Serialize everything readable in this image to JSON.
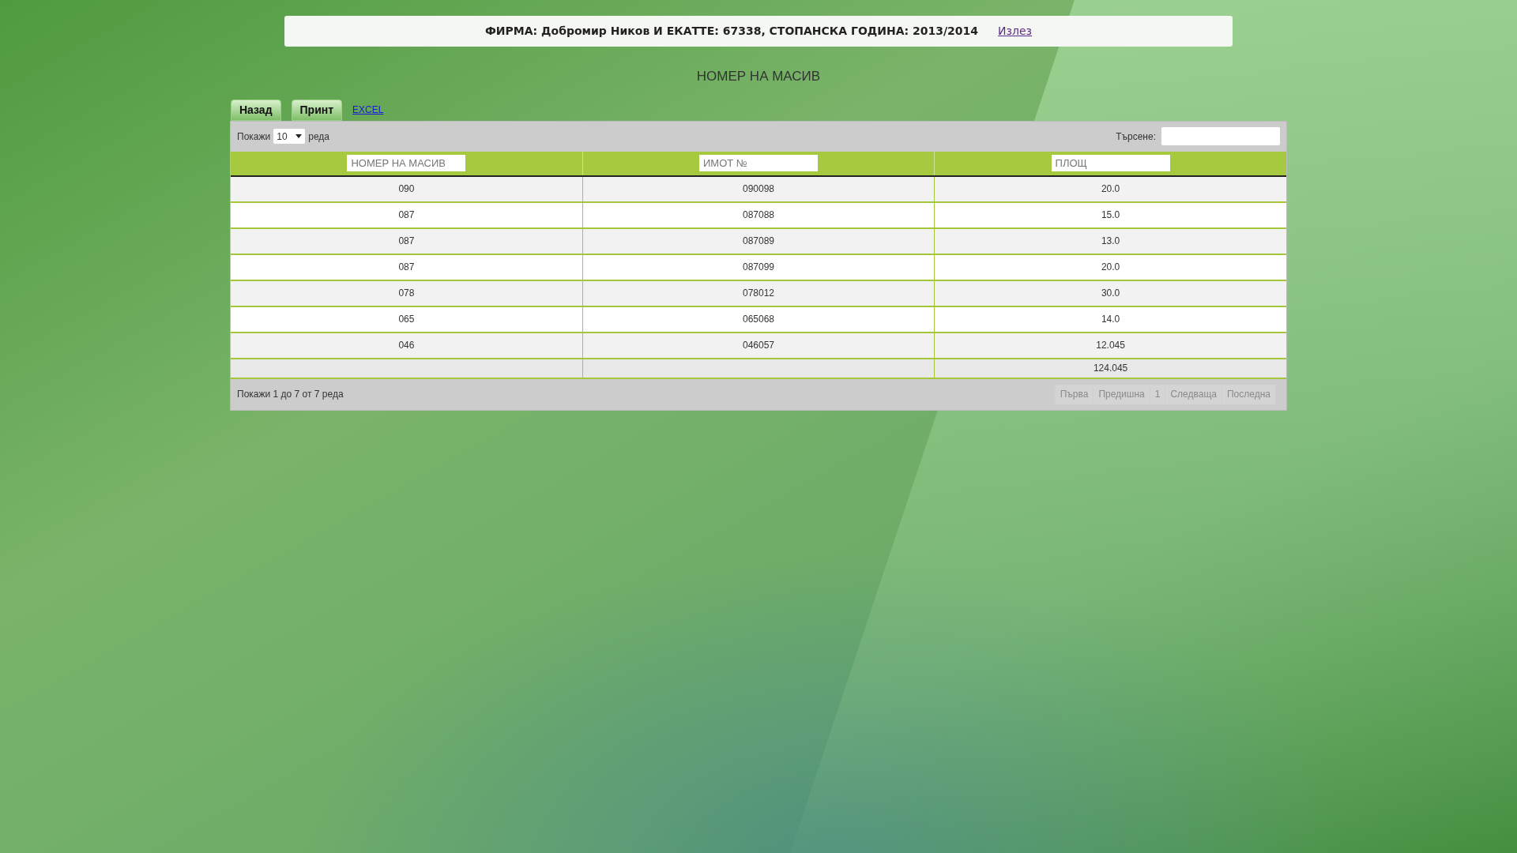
{
  "header_bar": {
    "text": "ФИРМА: Добромир Ников И ЕКАТТЕ: 67338, СТОПАНСКА ГОДИНА: 2013/2014",
    "logout_link": "Излез"
  },
  "page_title": "НОМЕР НА МАСИВ",
  "actions": [
    {
      "kind": "button",
      "label": "Назад"
    },
    {
      "kind": "button",
      "label": "Принт"
    },
    {
      "kind": "link",
      "label": "EXCEL"
    }
  ],
  "length_control": {
    "prefix": "Покажи",
    "value": "10",
    "suffix": "реда"
  },
  "search": {
    "label": "Търсене:"
  },
  "table": {
    "columns": [
      {
        "filter_placeholder": "НОМЕР НА МАСИВ"
      },
      {
        "filter_placeholder": "ИМОТ №"
      },
      {
        "filter_placeholder": "ПЛОЩ"
      }
    ],
    "rows": [
      [
        "090",
        "090098",
        "20.0"
      ],
      [
        "087",
        "087088",
        "15.0"
      ],
      [
        "087",
        "087089",
        "13.0"
      ],
      [
        "087",
        "087099",
        "20.0"
      ],
      [
        "078",
        "078012",
        "30.0"
      ],
      [
        "065",
        "065068",
        "14.0"
      ],
      [
        "046",
        "046057",
        "12.045"
      ]
    ],
    "total_row": {
      "column_3": "124.045"
    }
  },
  "info": "Покажи 1 до 7 от 7 реда",
  "pagination": [
    {
      "label": "Първа",
      "disabled": true
    },
    {
      "label": "Предишна",
      "disabled": true
    },
    {
      "label": "1",
      "disabled": true
    },
    {
      "label": "Следваща",
      "disabled": true
    },
    {
      "label": "Последна",
      "disabled": true
    }
  ]
}
